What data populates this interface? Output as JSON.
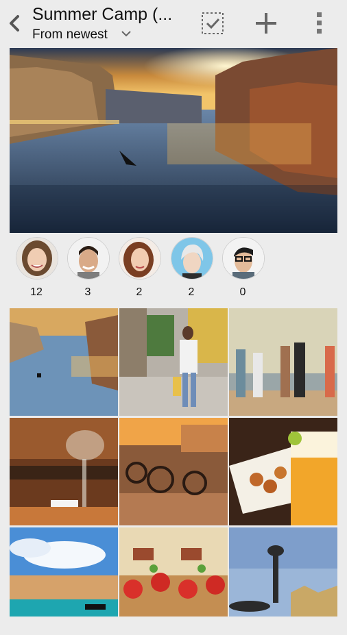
{
  "header": {
    "title": "Summer Camp (...",
    "sort_label": "From newest",
    "icons": {
      "back": "back-arrow-icon",
      "select": "select-all-icon",
      "add": "plus-icon",
      "more": "more-vertical-icon",
      "sort": "chevron-down-icon"
    }
  },
  "cover": {
    "subject": "venice-grand-canal-sunset"
  },
  "faces": [
    {
      "count": "12",
      "person": "smiling-woman-brown-hair"
    },
    {
      "count": "3",
      "person": "smiling-man-dark-hair"
    },
    {
      "count": "2",
      "person": "woman-auburn-hair"
    },
    {
      "count": "2",
      "person": "woman-short-silver-hair"
    },
    {
      "count": "0",
      "person": "man-with-glasses"
    }
  ],
  "photos": [
    {
      "subject": "venice-canal-dusk"
    },
    {
      "subject": "woman-walking-street"
    },
    {
      "subject": "friends-dancing-beach"
    },
    {
      "subject": "restaurant-wine-glasses"
    },
    {
      "subject": "cafe-terrace-chairs"
    },
    {
      "subject": "snacks-and-beer"
    },
    {
      "subject": "venice-blue-sky"
    },
    {
      "subject": "bruschetta-tomatoes"
    },
    {
      "subject": "fountain-statue-sky"
    }
  ],
  "colors": {
    "background": "#ececec",
    "text": "#111111",
    "icon": "#555555"
  }
}
